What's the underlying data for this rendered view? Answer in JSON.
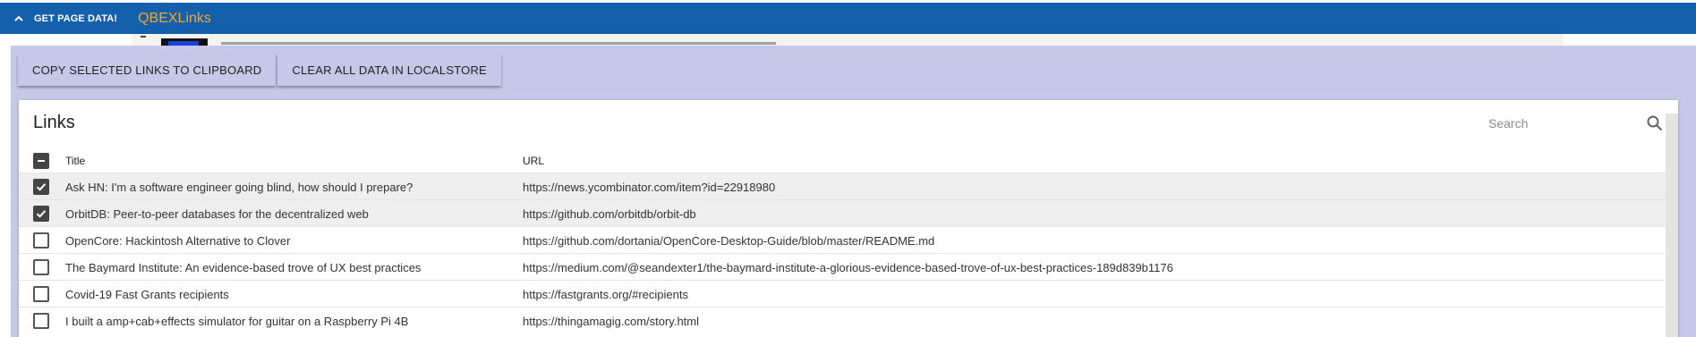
{
  "topbar": {
    "get_page_data_label": "GET PAGE DATA!",
    "brand": "QBEXLinks",
    "bg_color": "#1560ac",
    "brand_color": "#f5a623"
  },
  "actions": {
    "copy_label": "COPY SELECTED LINKS TO CLIPBOARD",
    "clear_label": "CLEAR ALL DATA IN LOCALSTORE"
  },
  "links_card": {
    "title": "Links",
    "search_placeholder": "Search",
    "columns": {
      "title": "Title",
      "url": "URL"
    },
    "rows": [
      {
        "title": "Ask HN: I'm a software engineer going blind, how should I prepare?",
        "url": "https://news.ycombinator.com/item?id=22918980",
        "selected": true
      },
      {
        "title": "OrbitDB: Peer-to-peer databases for the decentralized web",
        "url": "https://github.com/orbitdb/orbit-db",
        "selected": true
      },
      {
        "title": "OpenCore: Hackintosh Alternative to Clover",
        "url": "https://github.com/dortania/OpenCore-Desktop-Guide/blob/master/README.md",
        "selected": false
      },
      {
        "title": "The Baymard Institute: An evidence-based trove of UX best practices",
        "url": "https://medium.com/@seandexter1/the-baymard-institute-a-glorious-evidence-based-trove-of-ux-best-practices-189d839b1176",
        "selected": false
      },
      {
        "title": "Covid-19 Fast Grants recipients",
        "url": "https://fastgrants.org/#recipients",
        "selected": false
      },
      {
        "title": "I built a amp+cab+effects simulator for guitar on a Raspberry Pi 4B",
        "url": "https://thingamagig.com/story.html",
        "selected": false
      }
    ]
  },
  "icons": {
    "expand": "chevron-up-icon",
    "search": "search-icon",
    "select_all": "minus-icon",
    "checked": "check-icon"
  }
}
